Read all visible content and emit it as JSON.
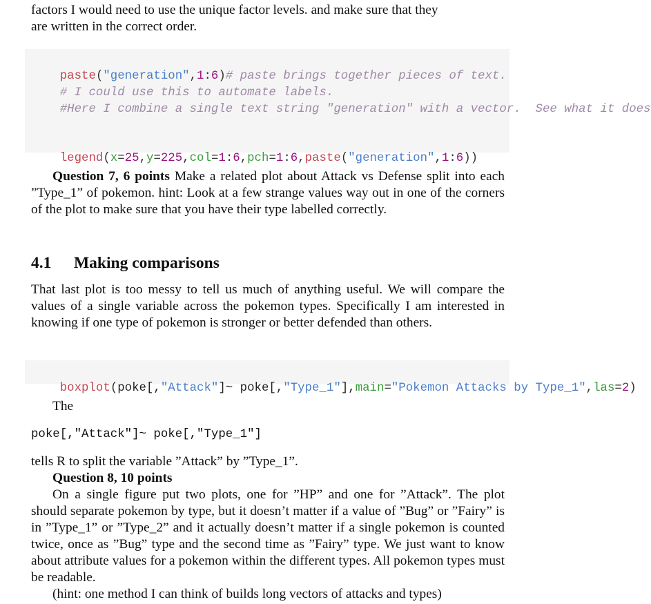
{
  "intro": {
    "lines": [
      "factors I would need to use the unique factor levels. and make sure that they",
      "are written in the correct order."
    ]
  },
  "code_block_1": {
    "line1": {
      "fn": "paste",
      "open": "(",
      "str": "\"generation\"",
      "comma": ",",
      "num_a": "1",
      "colon": ":",
      "num_b": "6",
      "close": ")",
      "comment": "# paste brings together pieces of text."
    },
    "line2": {
      "comment": "# I could use this to automate labels."
    },
    "line3": {
      "comment": "#Here I combine a single text string \"generation\" with a vector.  See what it does!"
    },
    "line4": {
      "fn": "legend",
      "open": "(",
      "arg_x": "x",
      "eq1": "=",
      "num_x": "25",
      "c1": ",",
      "arg_y": "y",
      "eq2": "=",
      "num_y": "225",
      "c2": ",",
      "arg_col": "col",
      "eq3": "=",
      "num_col_a": "1",
      "colon1": ":",
      "num_col_b": "6",
      "c3": ",",
      "arg_pch": "pch",
      "eq4": "=",
      "num_pch_a": "1",
      "colon2": ":",
      "num_pch_b": "6",
      "c4": ",",
      "fn2": "paste",
      "open2": "(",
      "str": "\"generation\"",
      "c5": ",",
      "num_p_a": "1",
      "colon3": ":",
      "num_p_b": "6",
      "close": "))"
    }
  },
  "question7": {
    "label": "Question 7, 6 points",
    "text": " Make a related plot about Attack vs Defense split into each ”Type_1” of pokemon. hint: Look at a few strange values way out in one of the corners of the plot to make sure that you have their type labelled correctly."
  },
  "section": {
    "number": "4.1",
    "title": "Making comparisons",
    "paragraph": "That last plot is too messy to tell us much of anything useful. We will compare the values of a single variable across the pokemon types.  Specifically I am interested in knowing if one type of pokemon is stronger or better defended than others."
  },
  "code_block_2": {
    "fn": "boxplot",
    "open": "(",
    "plain1": "poke[,",
    "str1": "\"Attack\"",
    "plain2": "]~ poke[,",
    "str2": "\"Type_1\"",
    "plain3": "],",
    "arg_main": "main",
    "eq1": "=",
    "str3": "\"Pokemon Attacks by Type_1\"",
    "c1": ",",
    "arg_las": "las",
    "eq2": "=",
    "num_las": "2",
    "close": ")"
  },
  "explanation": {
    "the": "The",
    "inline_code": "poke[,\"Attack\"]~ poke[,\"Type_1\"]",
    "tells": "tells R to split the variable ”Attack” by ”Type_1”."
  },
  "question8": {
    "label": "Question 8, 10 points",
    "text": "On a single figure put two plots, one for ”HP” and one for ”Attack”. The plot should separate pokemon by type, but it doesn’t matter if a value of ”Bug” or ”Fairy” is in ”Type_1” or ”Type_2” and it actually doesn’t matter if a single pokemon is counted twice, once as ”Bug” type and the second time as ”Fairy” type. We just want to know about attribute values for a pokemon within the different types. All pokemon types must be readable.",
    "hint": "(hint: one method I can think of builds long vectors of attacks and types)"
  }
}
